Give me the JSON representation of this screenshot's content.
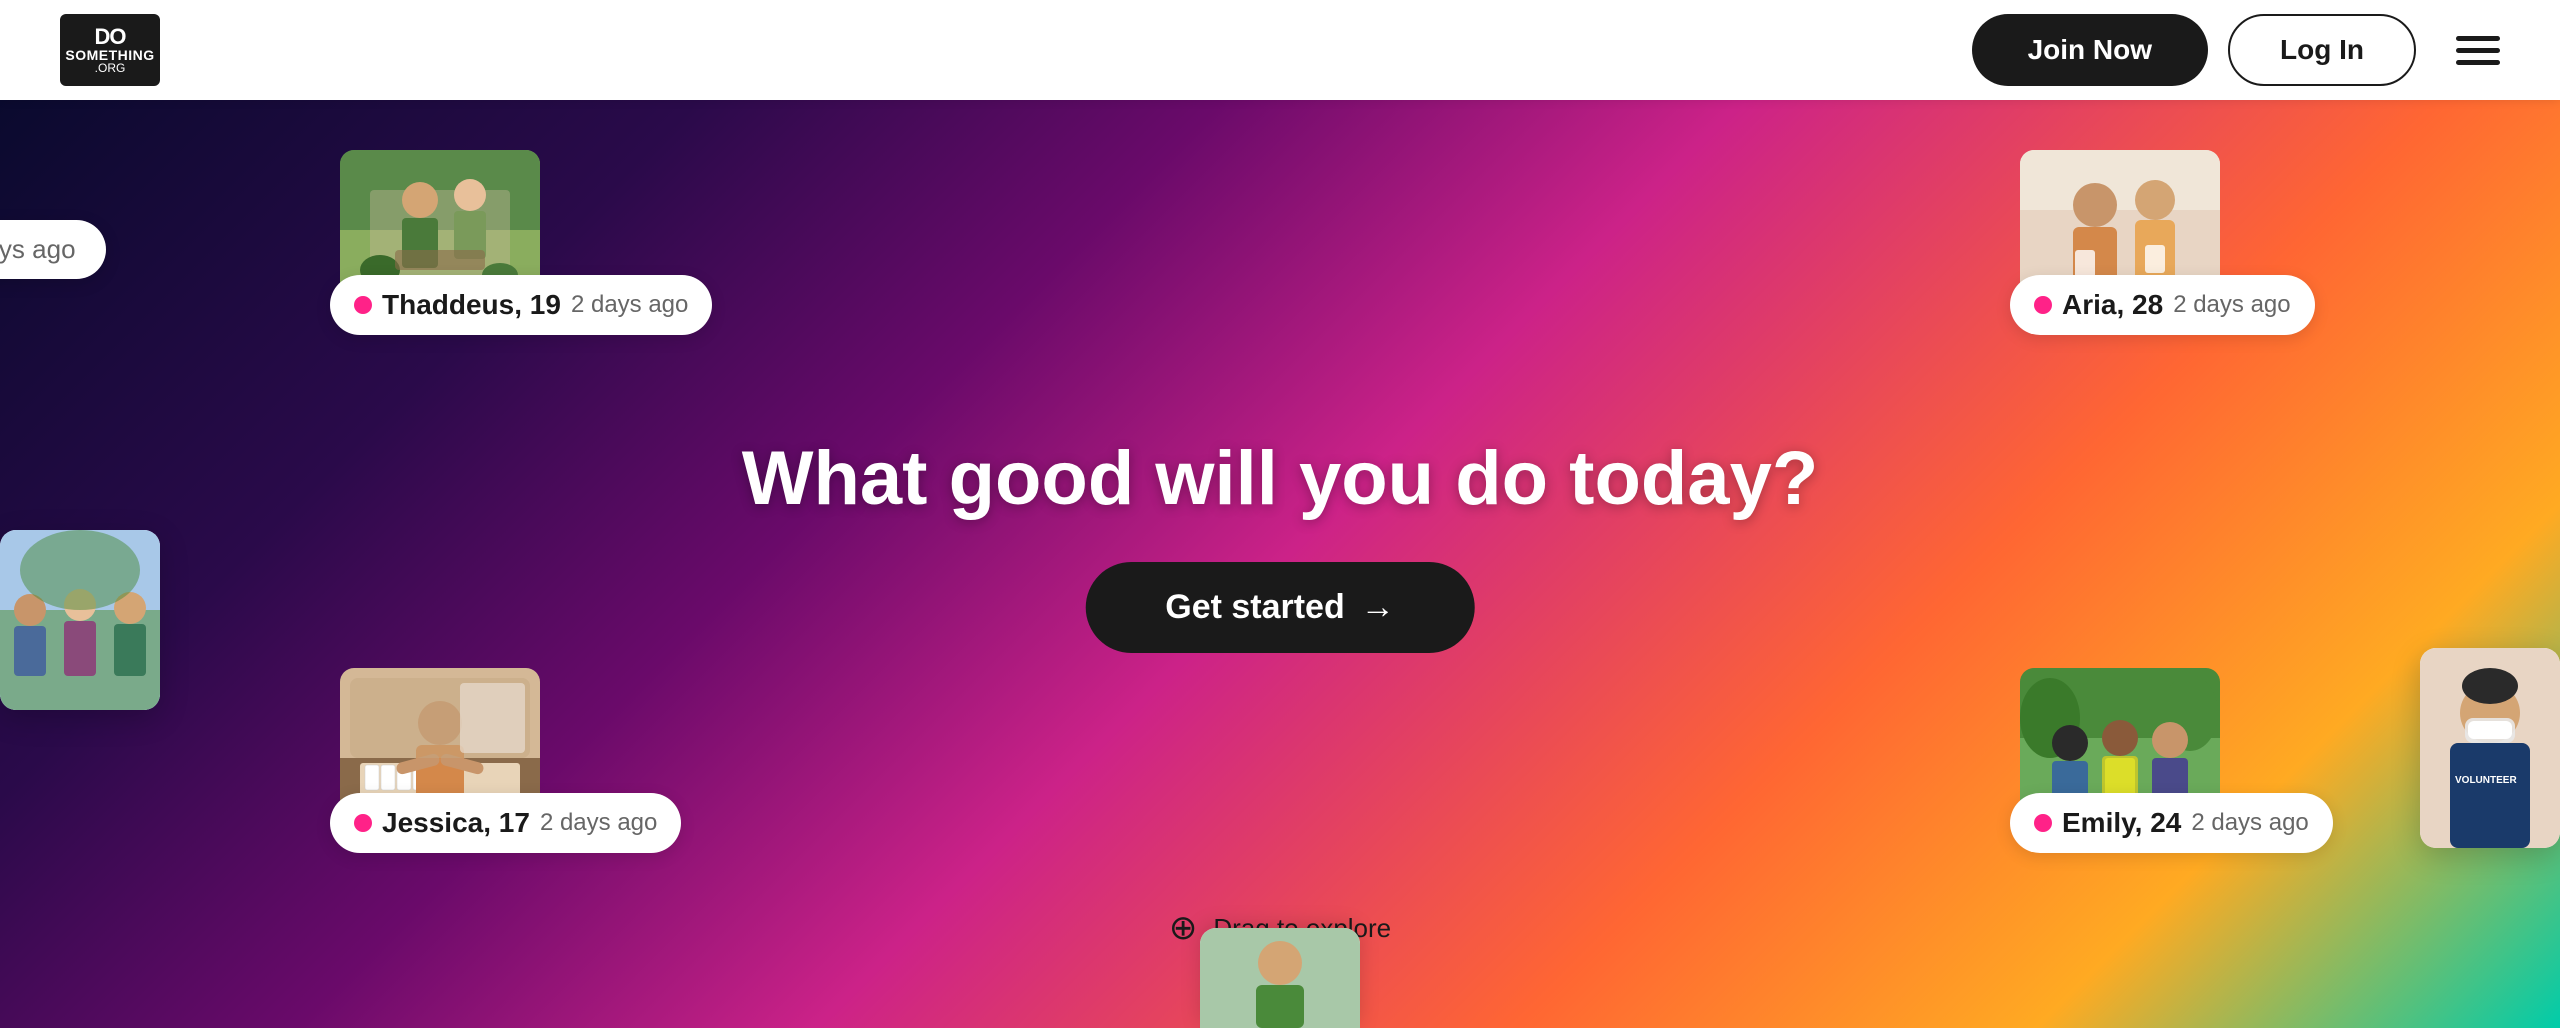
{
  "navbar": {
    "logo_line1": "DO",
    "logo_line2": "SOMETHING",
    "logo_org": ".ORG",
    "join_label": "Join Now",
    "login_label": "Log In"
  },
  "hero": {
    "headline": "What good will you do today?",
    "cta_label": "Get started",
    "drag_label": "Drag to explore"
  },
  "cards": [
    {
      "id": "thaddeus",
      "name": "Thaddeus,",
      "age": "19",
      "time": "2 days ago",
      "image_type": "garden"
    },
    {
      "id": "aria",
      "name": "Aria,",
      "age": "28",
      "time": "2 days ago",
      "image_type": "women"
    },
    {
      "id": "jessica",
      "name": "Jessica,",
      "age": "17",
      "time": "2 days ago",
      "image_type": "piano"
    },
    {
      "id": "emily",
      "name": "Emily,",
      "age": "24",
      "time": "2 days ago",
      "image_type": "volunteers"
    }
  ],
  "partial_left": {
    "text": "days ago"
  }
}
